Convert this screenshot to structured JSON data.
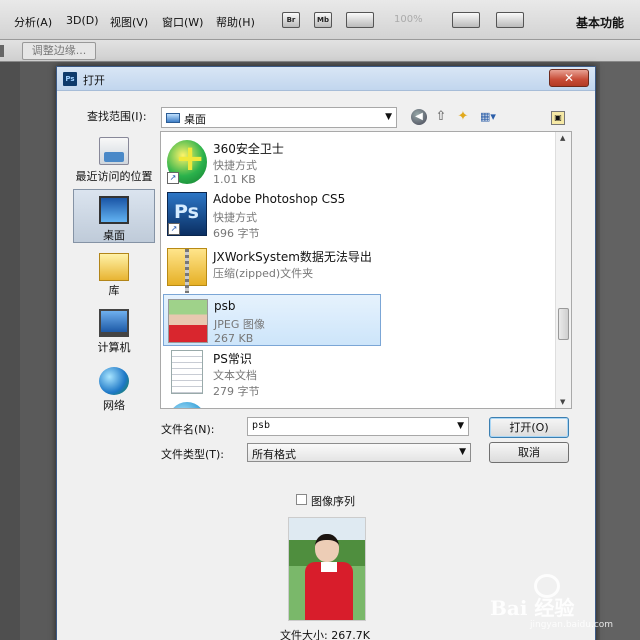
{
  "photoshop": {
    "menus": [
      "分析(A)",
      "3D(D)",
      "视图(V)",
      "窗口(W)",
      "帮助(H)"
    ],
    "toolbar_icons": [
      "Br",
      "Mb"
    ],
    "zoom": "100%",
    "workspace": "基本功能",
    "refine_edge_label": "调整边缘..."
  },
  "dialog": {
    "title": "打开",
    "close_glyph": "✕",
    "look_in_label": "查找范围(I):",
    "look_in_value": "桌面",
    "places": [
      {
        "label": "最近访问的位置",
        "icon": "recent-places-icon"
      },
      {
        "label": "桌面",
        "icon": "desktop-icon"
      },
      {
        "label": "库",
        "icon": "library-icon"
      },
      {
        "label": "计算机",
        "icon": "computer-icon"
      },
      {
        "label": "网络",
        "icon": "network-icon"
      }
    ],
    "files": [
      {
        "name": "360安全卫士",
        "type": "快捷方式",
        "size": "1.01 KB",
        "icon": "360-icon"
      },
      {
        "name": "Adobe Photoshop CS5",
        "type": "快捷方式",
        "size": "696 字节",
        "icon": "photoshop-icon"
      },
      {
        "name": "JXWorkSystem数据无法导出",
        "type": "压缩(zipped)文件夹",
        "size": "",
        "icon": "zip-folder-icon"
      },
      {
        "name": "psb",
        "type": "JPEG 图像",
        "size": "267 KB",
        "icon": "jpeg-thumbnail-icon"
      },
      {
        "name": "PS常识",
        "type": "文本文档",
        "size": "279 字节",
        "icon": "text-document-icon"
      }
    ],
    "filename_label": "文件名(N):",
    "filename_value": "psb",
    "filetype_label": "文件类型(T):",
    "filetype_value": "所有格式",
    "open_button": "打开(O)",
    "cancel_button": "取消",
    "image_sequence_label": "图像序列",
    "file_size_text": "文件大小: 267.7K"
  },
  "watermark": {
    "text": "Bai 经验",
    "url": "jingyan.baidu.com"
  }
}
